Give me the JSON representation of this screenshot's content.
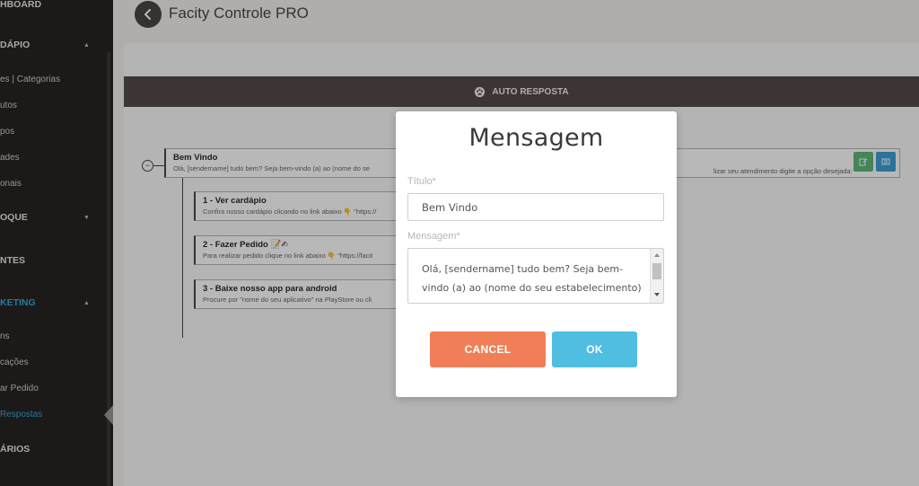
{
  "sidebar": {
    "items": [
      {
        "label": "HBOARD",
        "type": "section"
      },
      {
        "label": "DÁPIO",
        "type": "section",
        "chevron": "up"
      },
      {
        "label": "es | Categorias",
        "type": "sub"
      },
      {
        "label": "utos",
        "type": "sub"
      },
      {
        "label": "pos",
        "type": "sub"
      },
      {
        "label": "ades",
        "type": "sub"
      },
      {
        "label": "onais",
        "type": "sub"
      },
      {
        "label": "OQUE",
        "type": "section",
        "chevron": "down"
      },
      {
        "label": "NTES",
        "type": "section"
      },
      {
        "label": "KETING",
        "type": "section",
        "chevron": "up",
        "active": true
      },
      {
        "label": "ns",
        "type": "sub"
      },
      {
        "label": "cações",
        "type": "sub"
      },
      {
        "label": "ar Pedido",
        "type": "sub"
      },
      {
        "label": "Respostas",
        "type": "sub",
        "active": true
      },
      {
        "label": "ÁRIOS",
        "type": "section"
      }
    ]
  },
  "header": {
    "title": "Facity Controle PRO"
  },
  "panel": {
    "title": "AUTO RESPOSTA",
    "root": {
      "title": "Bem Vindo",
      "text_left": "Olá, [sendername] tudo bem? Seja bem-vindo (a) ao (nome do se",
      "text_right": "lizar seu atendimento digite a opção desejada:"
    },
    "children": [
      {
        "title": "1 - Ver cardápio",
        "text": "Confira nosso cardápio clicando no link abaixo 👇 \"https://"
      },
      {
        "title": "2 - Fazer Pedido 📝✍",
        "text": "Para realizar pedido clique no link abaixo 👇 \"https://facit"
      },
      {
        "title": "3 - Baixe nosso app para android",
        "text": "Procure por \"nome do seu aplicativo\" na PlayStore ou cli"
      }
    ]
  },
  "modal": {
    "title": "Mensagem",
    "title_label": "Título*",
    "title_value": "Bem Vindo",
    "message_label": "Mensagem*",
    "message_value": "Olá, [sendername] tudo bem? Seja bem-vindo (a) ao (nome do seu estabelecimento)",
    "cancel_label": "CANCEL",
    "ok_label": "OK"
  },
  "colors": {
    "sidebar_bg": "#262422",
    "header_bar": "#524c48",
    "cancel": "#f07f57",
    "ok": "#4fbee0",
    "edit": "#5fb97c",
    "list": "#3ea0d6",
    "active_link": "#3ba6e0"
  },
  "icons": [
    "chevron-left-icon",
    "dashboard-icon",
    "edit-icon",
    "list-icon",
    "chevron-up-icon",
    "chevron-down-icon"
  ]
}
